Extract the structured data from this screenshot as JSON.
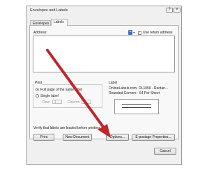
{
  "window": {
    "title": "Envelopes and Labels",
    "help_label": "?",
    "close_label": "×"
  },
  "tabs": [
    {
      "label": "Envelopes"
    },
    {
      "label": "Labels"
    }
  ],
  "address": {
    "label": "Address:",
    "use_return_label": "Use return address"
  },
  "print_group": {
    "title": "Print",
    "full_page_label": "Full page of the same label",
    "single_label": "Single label",
    "row_label": "Row:",
    "row_value": "1",
    "column_label": "Column:",
    "column_value": "1"
  },
  "label_group": {
    "title": "Label",
    "line1": "OnlineLabels.com, OL1050 - Rectan...",
    "line2": "Rounded Corners - 64 Per Sheet"
  },
  "verify_text": "Verify that labels are loaded before printing.",
  "buttons": {
    "print": "Print",
    "new_document": "New Document",
    "options": "Options...",
    "epostage": "E-postage Properties...",
    "cancel": "Cancel"
  },
  "colors": {
    "arrow": "#c0262b",
    "dialog_bg": "#f0f0f0"
  }
}
